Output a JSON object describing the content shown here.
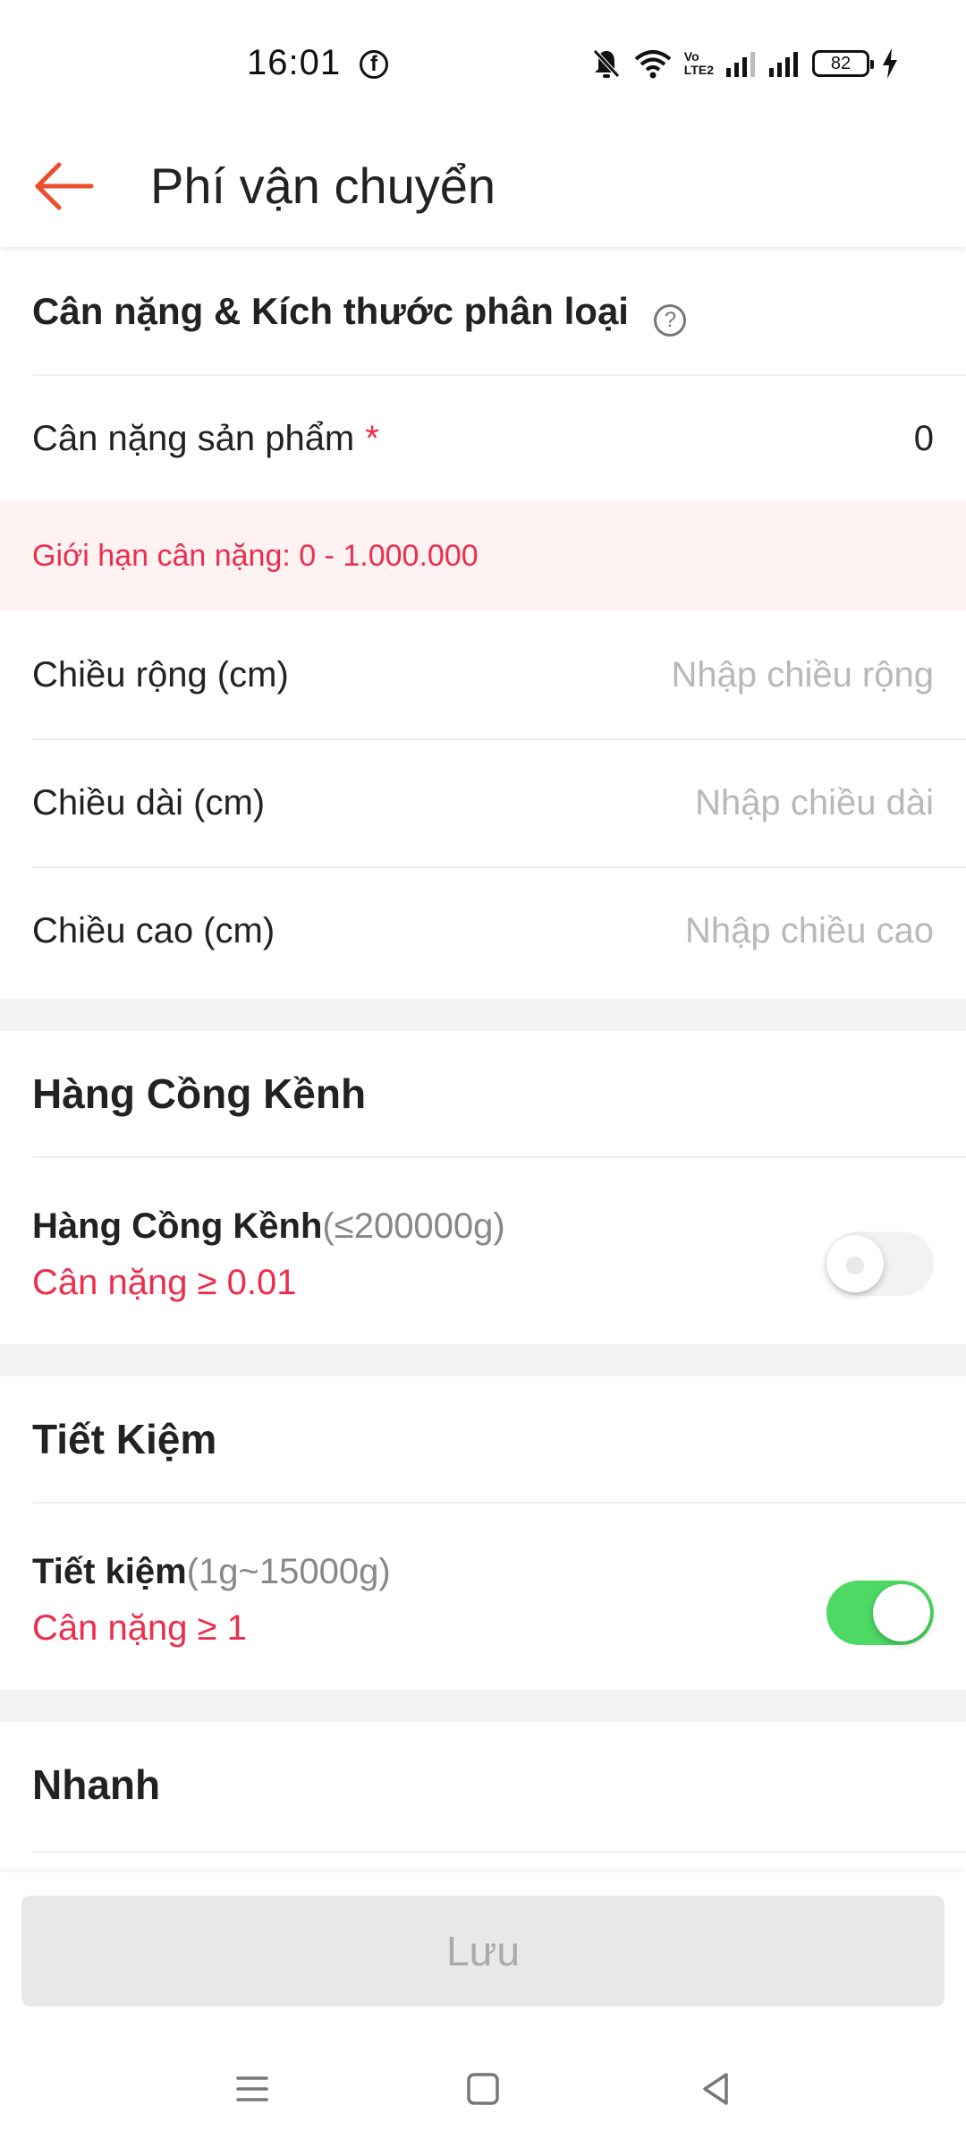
{
  "status_bar": {
    "time": "16:01",
    "battery": "82",
    "volte": "Vo LTE2"
  },
  "app_bar": {
    "title": "Phí vận chuyển"
  },
  "dimensions": {
    "header": "Cân nặng & Kích thước phân loại",
    "weight_label": "Cân nặng sản phẩm",
    "required_mark": "*",
    "weight_value": "0",
    "weight_error": "Giới hạn cân nặng: 0 - 1.000.000",
    "width_label": "Chiều rộng (cm)",
    "width_placeholder": "Nhập chiều rộng",
    "length_label": "Chiều dài (cm)",
    "length_placeholder": "Nhập chiều dài",
    "height_label": "Chiều cao (cm)",
    "height_placeholder": "Nhập chiều cao"
  },
  "shipping": [
    {
      "section_title": "Hàng Cồng Kềnh",
      "option_name": "Hàng Cồng Kềnh",
      "option_range": "(≤200000g)",
      "option_note": "Cân nặng ≥ 0.01",
      "enabled": false
    },
    {
      "section_title": "Tiết Kiệm",
      "option_name": "Tiết kiệm",
      "option_range": "(1g~15000g)",
      "option_note": "Cân nặng ≥ 1",
      "enabled": true
    },
    {
      "section_title": "Nhanh"
    }
  ],
  "footer": {
    "save_label": "Lưu"
  },
  "colors": {
    "accent": "#ee4d2d",
    "error": "#ee2d4a",
    "toggle_on": "#4cd964"
  },
  "icons": [
    "back-arrow-icon",
    "facebook-icon",
    "bell-off-icon",
    "wifi-icon",
    "signal-icon",
    "battery-icon",
    "charging-icon",
    "help-circle-icon",
    "menu-icon",
    "home-square-icon",
    "back-triangle-icon"
  ]
}
